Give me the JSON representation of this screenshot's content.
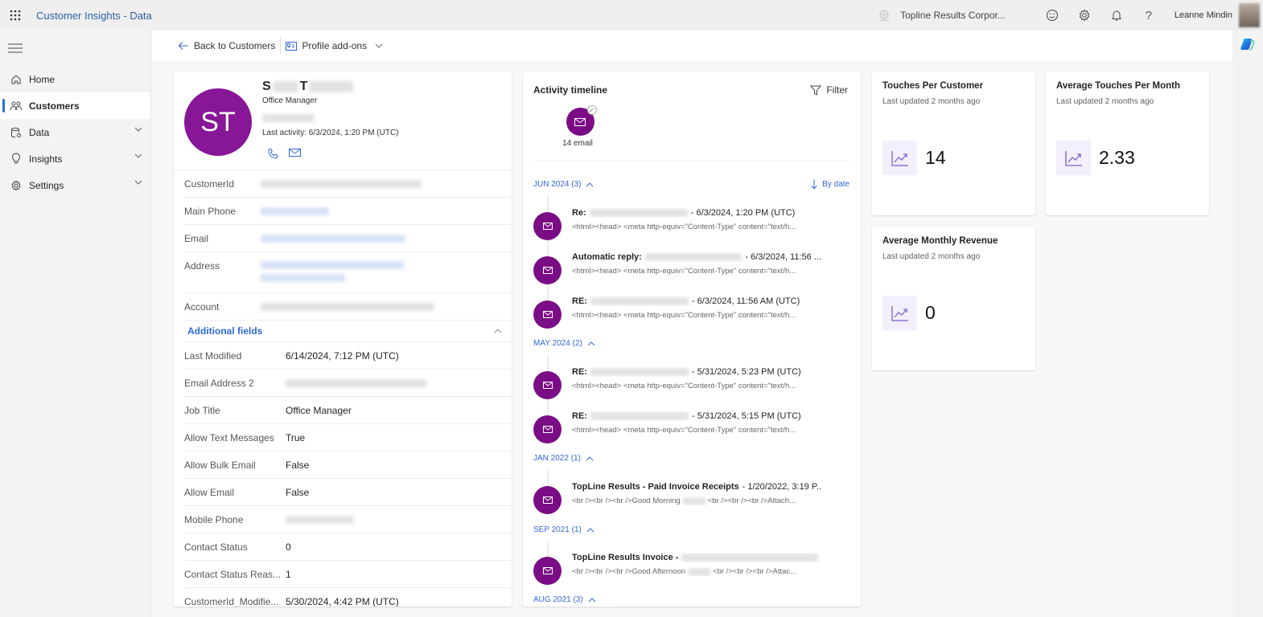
{
  "app": {
    "title": "Customer Insights - Data",
    "org_name": "Topline Results Corpor...",
    "user_name": "Leanne Mindin"
  },
  "sidebar": {
    "items": [
      {
        "label": "Home",
        "icon": "home-icon",
        "active": false,
        "expandable": false
      },
      {
        "label": "Customers",
        "icon": "people-icon",
        "active": true,
        "expandable": false
      },
      {
        "label": "Data",
        "icon": "database-icon",
        "active": false,
        "expandable": true
      },
      {
        "label": "Insights",
        "icon": "lightbulb-icon",
        "active": false,
        "expandable": true
      },
      {
        "label": "Settings",
        "icon": "gear-icon",
        "active": false,
        "expandable": true
      }
    ]
  },
  "commandbar": {
    "back_label": "Back to Customers",
    "addons_label": "Profile add-ons"
  },
  "profile": {
    "initials": "ST",
    "name_first_initial": "S",
    "name_last_initial": "T",
    "job_title": "Office Manager",
    "last_activity": "Last activity: 6/3/2024, 1:20 PM (UTC)",
    "fields": [
      {
        "label": "CustomerId",
        "value": "[redacted]"
      },
      {
        "label": "Main Phone",
        "value": "[redacted]"
      },
      {
        "label": "Email",
        "value": "[redacted]"
      },
      {
        "label": "Address",
        "value": "[redacted]"
      },
      {
        "label": "Account",
        "value": "[redacted]"
      }
    ],
    "additional_fields_label": "Additional fields",
    "additional_fields": [
      {
        "label": "Last Modified",
        "value": "6/14/2024, 7:12 PM (UTC)"
      },
      {
        "label": "Email Address 2",
        "value": "[redacted]"
      },
      {
        "label": "Job Title",
        "value": "Office Manager"
      },
      {
        "label": "Allow Text Messages",
        "value": "True"
      },
      {
        "label": "Allow Bulk Email",
        "value": "False"
      },
      {
        "label": "Allow Email",
        "value": "False"
      },
      {
        "label": "Mobile Phone",
        "value": "[redacted]"
      },
      {
        "label": "Contact Status",
        "value": "0"
      },
      {
        "label": "Contact Status Reas...",
        "value": "1"
      },
      {
        "label": "CustomerId_Modifie...",
        "value": "5/30/2024, 4:42 PM (UTC)"
      }
    ]
  },
  "timeline": {
    "title": "Activity timeline",
    "filter_label": "Filter",
    "summary_label": "14 email",
    "sort_label": "By date",
    "groups": [
      {
        "label": "JUN 2024 (3)",
        "items": [
          {
            "prefix": "Re:",
            "suffix": "- 6/3/2024, 1:20 PM (UTC)",
            "preview": "<html><head>  <meta http-equiv=\"Content-Type\" content=\"text/h..."
          },
          {
            "prefix": "Automatic reply:",
            "suffix": "- 6/3/2024, 11:56 ...",
            "preview": "<html><head>  <meta http-equiv=\"Content-Type\" content=\"text/h..."
          },
          {
            "prefix": "RE:",
            "suffix": "- 6/3/2024, 11:56 AM (UTC)",
            "preview": "<html><head>  <meta http-equiv=\"Content-Type\" content=\"text/h..."
          }
        ]
      },
      {
        "label": "MAY 2024 (2)",
        "items": [
          {
            "prefix": "RE:",
            "suffix": "- 5/31/2024, 5:23 PM (UTC)",
            "preview": "<html><head>  <meta http-equiv=\"Content-Type\" content=\"text/h..."
          },
          {
            "prefix": "RE:",
            "suffix": "- 5/31/2024, 5:15 PM (UTC)",
            "preview": "<html><head>  <meta http-equiv=\"Content-Type\" content=\"text/h..."
          }
        ]
      },
      {
        "label": "JAN 2022 (1)",
        "items": [
          {
            "prefix": "TopLine Results - Paid Invoice Receipts",
            "suffix": "- 1/20/2022, 3:19 P...",
            "preview_a": "<br /><br /><br />Good Morning",
            "preview_b": "<br /><br /><br />Attach..."
          }
        ]
      },
      {
        "label": "SEP 2021 (1)",
        "items": [
          {
            "prefix": "TopLine Results Invoice -",
            "suffix": "",
            "preview_a": "<br /><br /><br />Good Afternoon",
            "preview_b": "<br /><br /><br />Attac..."
          }
        ]
      },
      {
        "label": "AUG 2021 (3)",
        "items": []
      }
    ]
  },
  "kpis": [
    {
      "title": "Touches Per Customer",
      "subtitle": "Last updated 2 months ago",
      "value": "14"
    },
    {
      "title": "Average Touches Per Month",
      "subtitle": "Last updated 2 months ago",
      "value": "2.33"
    },
    {
      "title": "Average Monthly Revenue",
      "subtitle": "Last updated 2 months ago",
      "value": "0"
    }
  ],
  "colors": {
    "accent": "#3068d8",
    "avatar": "#881798",
    "email_icon": "#7a0d85",
    "kpi_icon_bg": "#f3effc",
    "kpi_icon_fg": "#7b5fc9"
  }
}
